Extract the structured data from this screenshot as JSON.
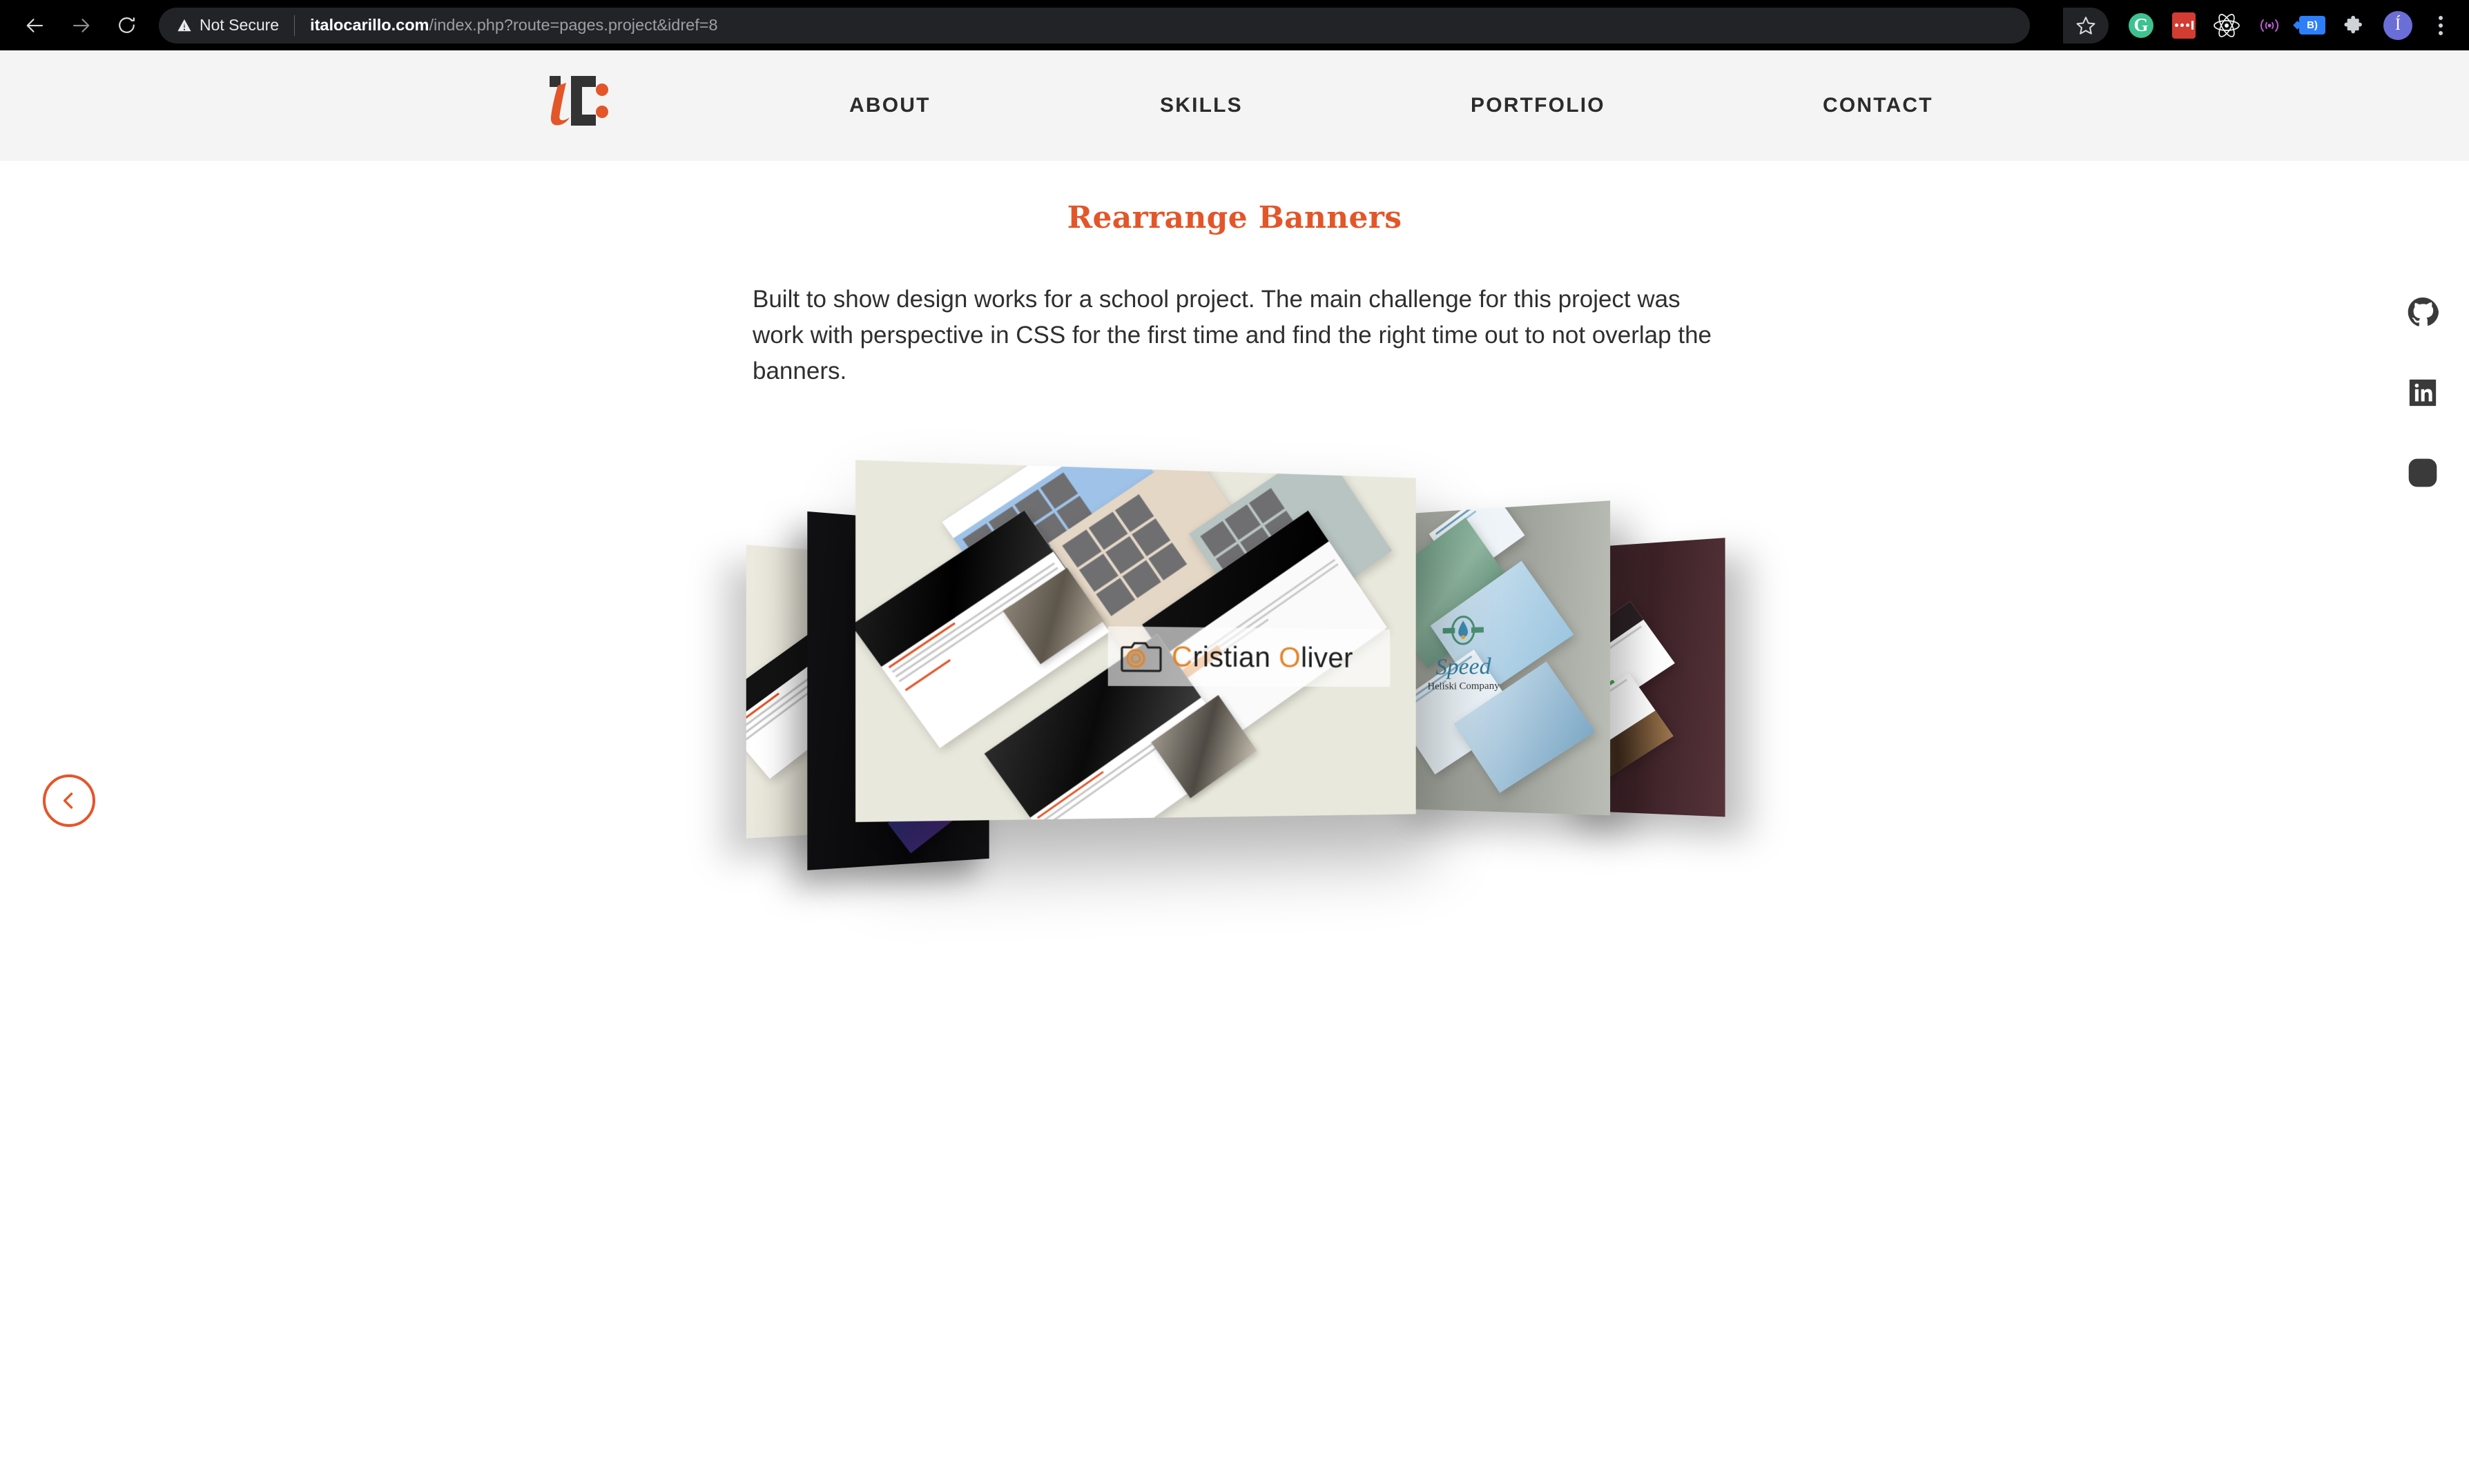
{
  "browser": {
    "back_icon": "arrow-left-icon",
    "forward_icon": "arrow-right-icon",
    "reload_icon": "reload-icon",
    "security_label": "Not Secure",
    "warning_icon": "warning-triangle-icon",
    "url_host": "italocarillo.com",
    "url_path": "/index.php?route=pages.project&idref=8",
    "bookmark_icon": "star-icon",
    "extensions": [
      {
        "name": "grammarly-extension-icon",
        "glyph": "G",
        "color": "#3ec28f"
      },
      {
        "name": "lastpass-extension-icon",
        "glyph": "•••",
        "color": "#d23c32"
      },
      {
        "name": "react-devtools-extension-icon",
        "glyph": "atom",
        "color": "#ffffff"
      },
      {
        "name": "cast-wireless-icon",
        "glyph": "((•))",
        "color": "#c05cd6"
      },
      {
        "name": "bookmark-tag-extension-icon",
        "glyph": "B)",
        "color": "#2d7ff9"
      },
      {
        "name": "extensions-puzzle-icon",
        "glyph": "puzzle",
        "color": "#cfd2d6"
      }
    ],
    "profile_initial": "Í",
    "profile_color": "#6b6ed6",
    "menu_icon": "kebab-menu-icon"
  },
  "site": {
    "logo_alt": "iC",
    "logo_accent": "#e3562a",
    "logo_dark": "#333333",
    "nav": [
      {
        "label": "ABOUT"
      },
      {
        "label": "SKILLS"
      },
      {
        "label": "PORTFOLIO"
      },
      {
        "label": "CONTACT"
      }
    ]
  },
  "project": {
    "title": "Rearrange Banners",
    "title_color": "#e3562a",
    "description": "Built to show design works for a school project. The main challenge for this project was work with perspective in CSS for the first time and find the right time out to not overlap the banners."
  },
  "social": [
    {
      "name": "github-icon",
      "label": "GitHub"
    },
    {
      "name": "linkedin-icon",
      "label": "LinkedIn"
    },
    {
      "name": "instagram-icon",
      "label": "Instagram"
    }
  ],
  "back_button": {
    "icon": "chevron-left-icon",
    "color": "#e3562a"
  },
  "banner_showcase": {
    "panels": [
      {
        "name": "banner-panel-far-left",
        "color": "#e8e6da"
      },
      {
        "name": "banner-panel-black",
        "color": "#0c0c0f"
      },
      {
        "name": "banner-panel-main",
        "color": "#e9e8dc",
        "brand": "Cristian Oliver"
      },
      {
        "name": "banner-panel-gray",
        "color": "#9ea19a",
        "brand": "Speed"
      },
      {
        "name": "banner-panel-maroon",
        "color": "#43262b"
      }
    ],
    "main_brand": {
      "first": "C",
      "first_rest": "ristian ",
      "second": "O",
      "second_rest": "liver",
      "icon": "camera-icon",
      "accent": "#e3862a"
    },
    "gray_brand": {
      "word": "Speed",
      "subtitle": "Heliski Company"
    }
  }
}
